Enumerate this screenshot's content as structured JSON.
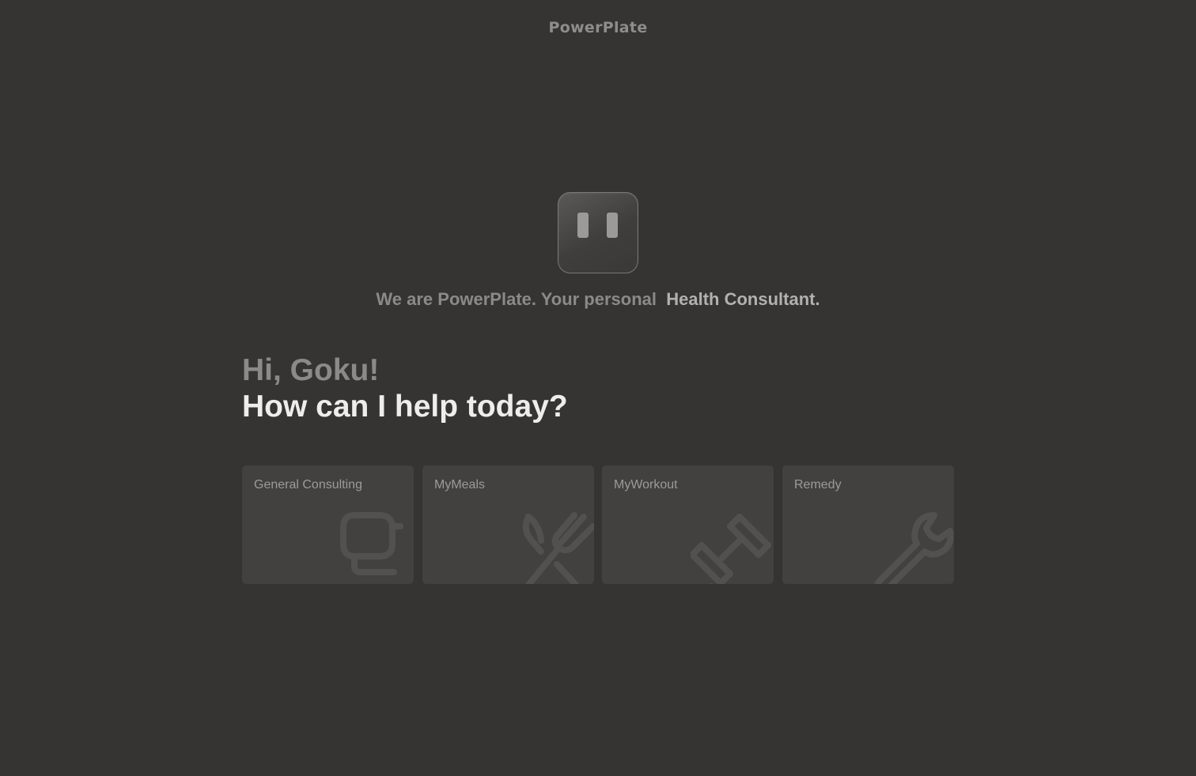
{
  "header": {
    "brand": "PowerPlate"
  },
  "hero": {
    "logo_icon": "robot-face-icon",
    "tagline_prefix": "We are PowerPlate. Your personal  ",
    "tagline_accent": "Health Consultant."
  },
  "greeting": {
    "hello": "Hi, Goku!",
    "question": "How can I help today?"
  },
  "cards": [
    {
      "label": "General Consulting",
      "icon": "chat-bubble-icon"
    },
    {
      "label": "MyMeals",
      "icon": "fork-knife-icon"
    },
    {
      "label": "MyWorkout",
      "icon": "dumbbell-icon"
    },
    {
      "label": "Remedy",
      "icon": "wrench-icon"
    }
  ],
  "colors": {
    "background": "#353432",
    "card": "#42413f",
    "text_primary": "#efedea",
    "text_muted": "#8c8a86"
  }
}
